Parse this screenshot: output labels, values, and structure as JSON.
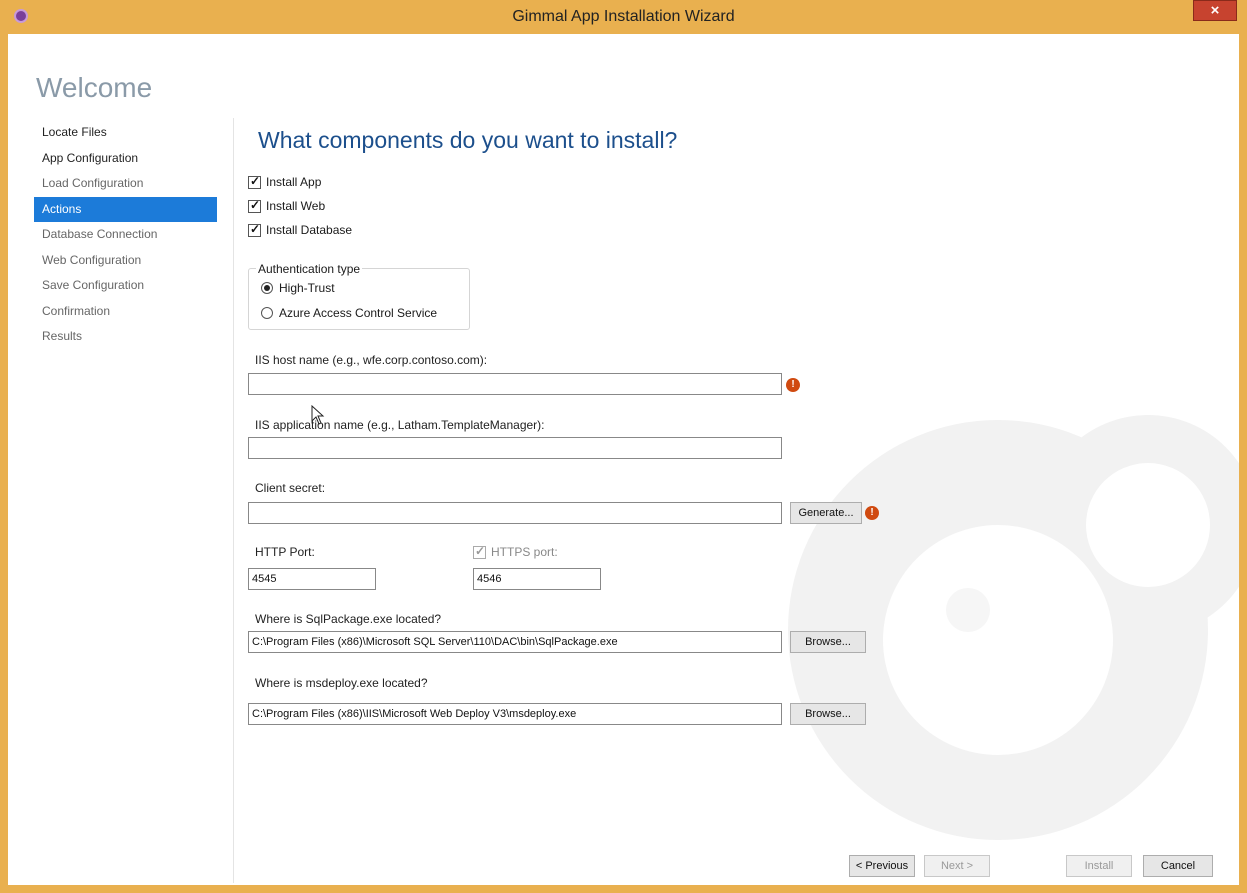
{
  "window": {
    "title": "Gimmal App Installation Wizard",
    "close_label": "×"
  },
  "page": {
    "welcome": "Welcome",
    "heading": "What components do you want to install?"
  },
  "nav": {
    "items": [
      {
        "label": "Locate Files",
        "state": "done"
      },
      {
        "label": "App Configuration",
        "state": "done"
      },
      {
        "label": "Load Configuration",
        "state": "dim"
      },
      {
        "label": "Actions",
        "state": "active"
      },
      {
        "label": "Database Connection",
        "state": "dim"
      },
      {
        "label": "Web Configuration",
        "state": "dim"
      },
      {
        "label": "Save Configuration",
        "state": "dim"
      },
      {
        "label": "Confirmation",
        "state": "dim"
      },
      {
        "label": "Results",
        "state": "dim"
      }
    ]
  },
  "components": {
    "install_app": {
      "label": "Install App",
      "checked": true
    },
    "install_web": {
      "label": "Install Web",
      "checked": true
    },
    "install_database": {
      "label": "Install Database",
      "checked": true
    }
  },
  "auth": {
    "legend": "Authentication type",
    "options": [
      {
        "label": "High-Trust",
        "selected": true
      },
      {
        "label": "Azure Access Control Service",
        "selected": false
      }
    ]
  },
  "iis_host": {
    "label": "IIS host name (e.g., wfe.corp.contoso.com):",
    "value": ""
  },
  "iis_app": {
    "label": "IIS application name (e.g., Latham.TemplateManager):",
    "value": ""
  },
  "client_secret": {
    "label": "Client secret:",
    "value": "",
    "generate_label": "Generate..."
  },
  "http_port": {
    "label": "HTTP Port:",
    "value": "4545"
  },
  "https_port": {
    "label": "HTTPS port:",
    "value": "4546",
    "checked": true
  },
  "sqlpackage": {
    "label": "Where is SqlPackage.exe located?",
    "value": "C:\\Program Files (x86)\\Microsoft SQL Server\\110\\DAC\\bin\\SqlPackage.exe",
    "browse_label": "Browse..."
  },
  "msdeploy": {
    "label": "Where is msdeploy.exe located?",
    "value": "C:\\Program Files (x86)\\IIS\\Microsoft Web Deploy V3\\msdeploy.exe",
    "browse_label": "Browse..."
  },
  "footer": {
    "previous": "< Previous",
    "next": "Next >",
    "install": "Install",
    "cancel": "Cancel"
  },
  "colors": {
    "title_bar": "#e9b04f",
    "nav_active": "#1c7bd9",
    "heading": "#1c4f8c",
    "warning": "#d04a10"
  }
}
